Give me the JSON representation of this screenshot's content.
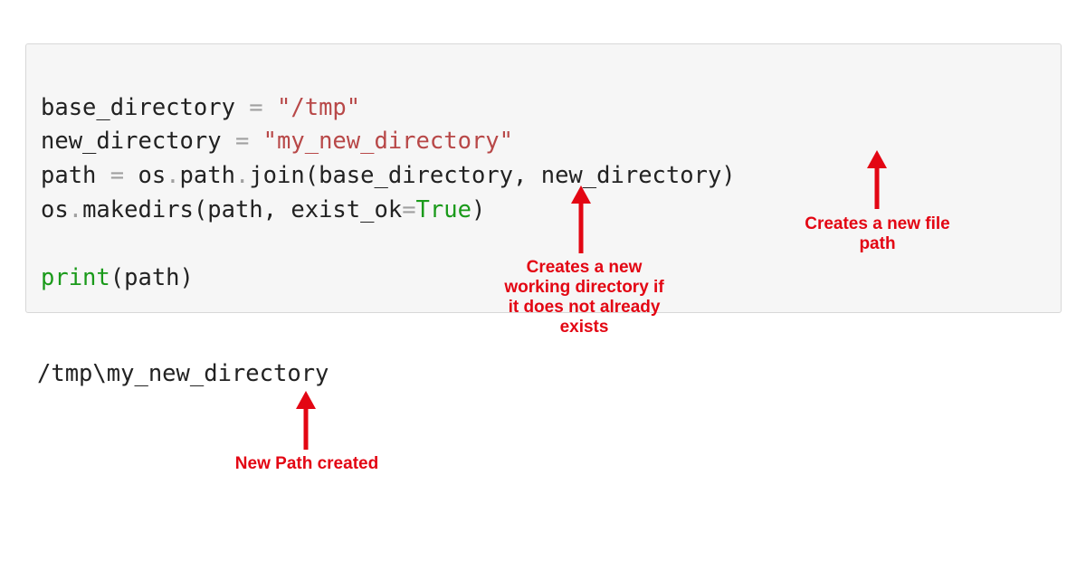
{
  "code": {
    "line1": {
      "a": "base_directory ",
      "b": "=",
      "c": " ",
      "d": "\"/tmp\""
    },
    "line2": {
      "a": "new_directory ",
      "b": "=",
      "c": " ",
      "d": "\"my_new_directory\""
    },
    "line3": {
      "a": "path ",
      "b": "=",
      "c": " os",
      "d": ".",
      "e": "path",
      "f": ".",
      "g": "join(base_directory, new_directory)"
    },
    "line4": {
      "a": "os",
      "b": ".",
      "c": "makedirs(path, exist_ok",
      "d": "=",
      "e": "True",
      "f": ")"
    },
    "blank": "",
    "line5": {
      "a": "print",
      "b": "(path)"
    }
  },
  "output": "/tmp\\my_new_directory",
  "annotations": {
    "makedirs": "Creates a new\nworking directory if\nit does not already\nexists",
    "join": "Creates a new file\npath",
    "newpath": "New Path created"
  },
  "colors": {
    "annotation": "#e30613",
    "code_bg": "#f6f6f6",
    "string": "#b84848",
    "keyword_green": "#1a9a1a"
  }
}
